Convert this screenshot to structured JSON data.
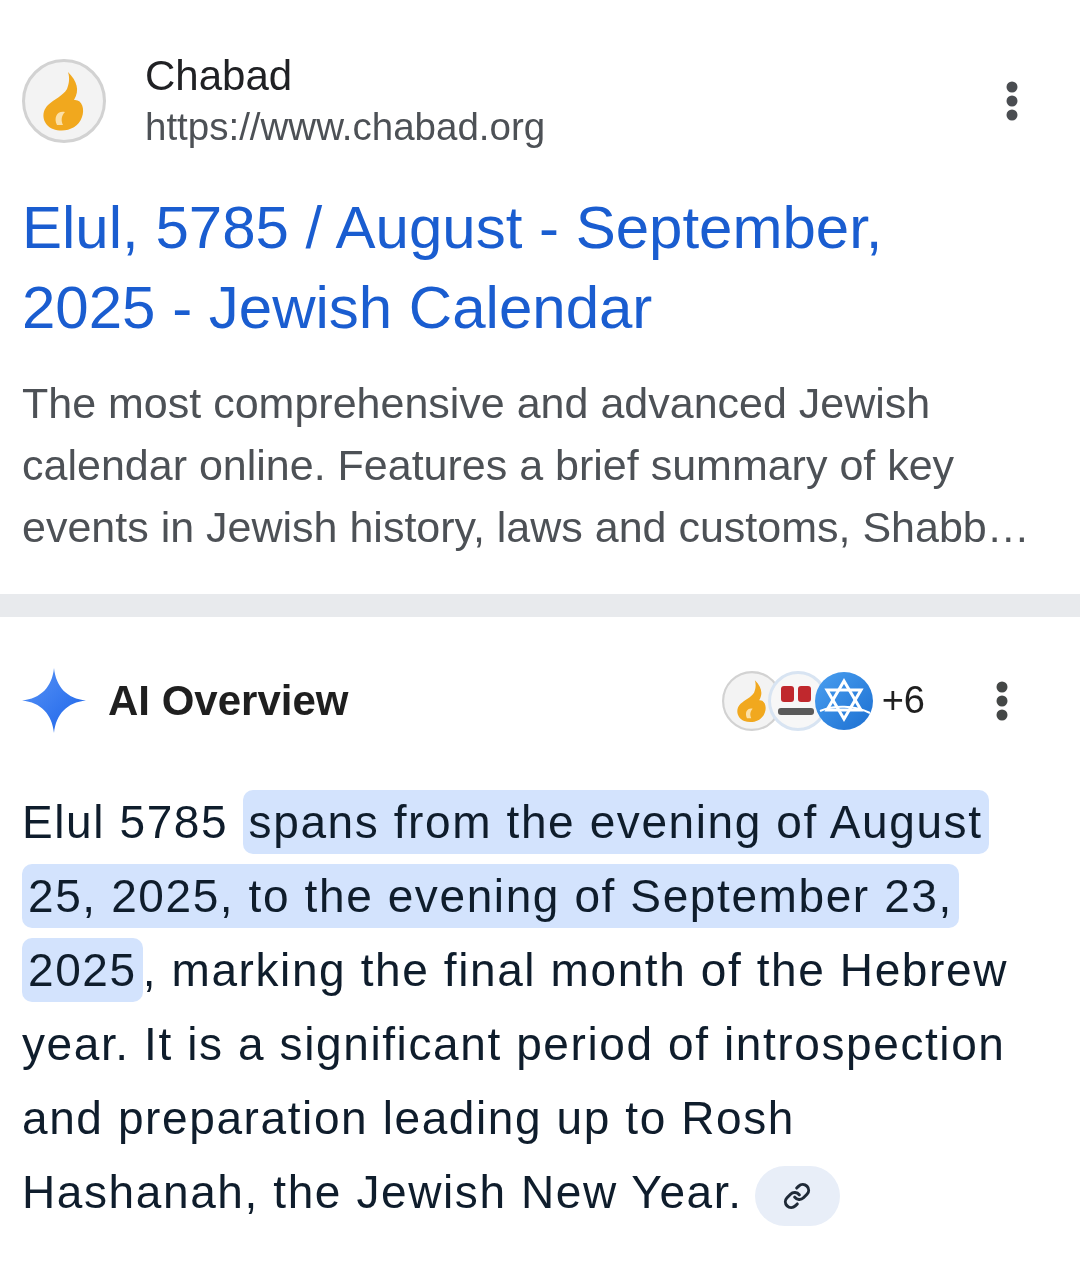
{
  "search_result": {
    "site_name": "Chabad",
    "url": "https://www.chabad.org",
    "title": "Elul, 5785 / August - September, 2025 - Jewish Calendar",
    "snippet": "The most comprehensive and advanced Jewish calendar online. Features a brief summary of key events in Jewish history, laws and customs, Shabb…"
  },
  "ai_overview": {
    "heading": "AI Overview",
    "more_sources": "+6",
    "summary": [
      {
        "text": "Elul 5785 ",
        "highlighted": false
      },
      {
        "text": "spans from the evening of August 25, 2025, to the evening of September 23, 2025",
        "highlighted": true
      },
      {
        "text": ", marking the final month of the Hebrew year. It is a significant period of introspection and preparation leading up to Rosh Hashanah, the Jewish New Year.",
        "highlighted": false
      }
    ]
  }
}
